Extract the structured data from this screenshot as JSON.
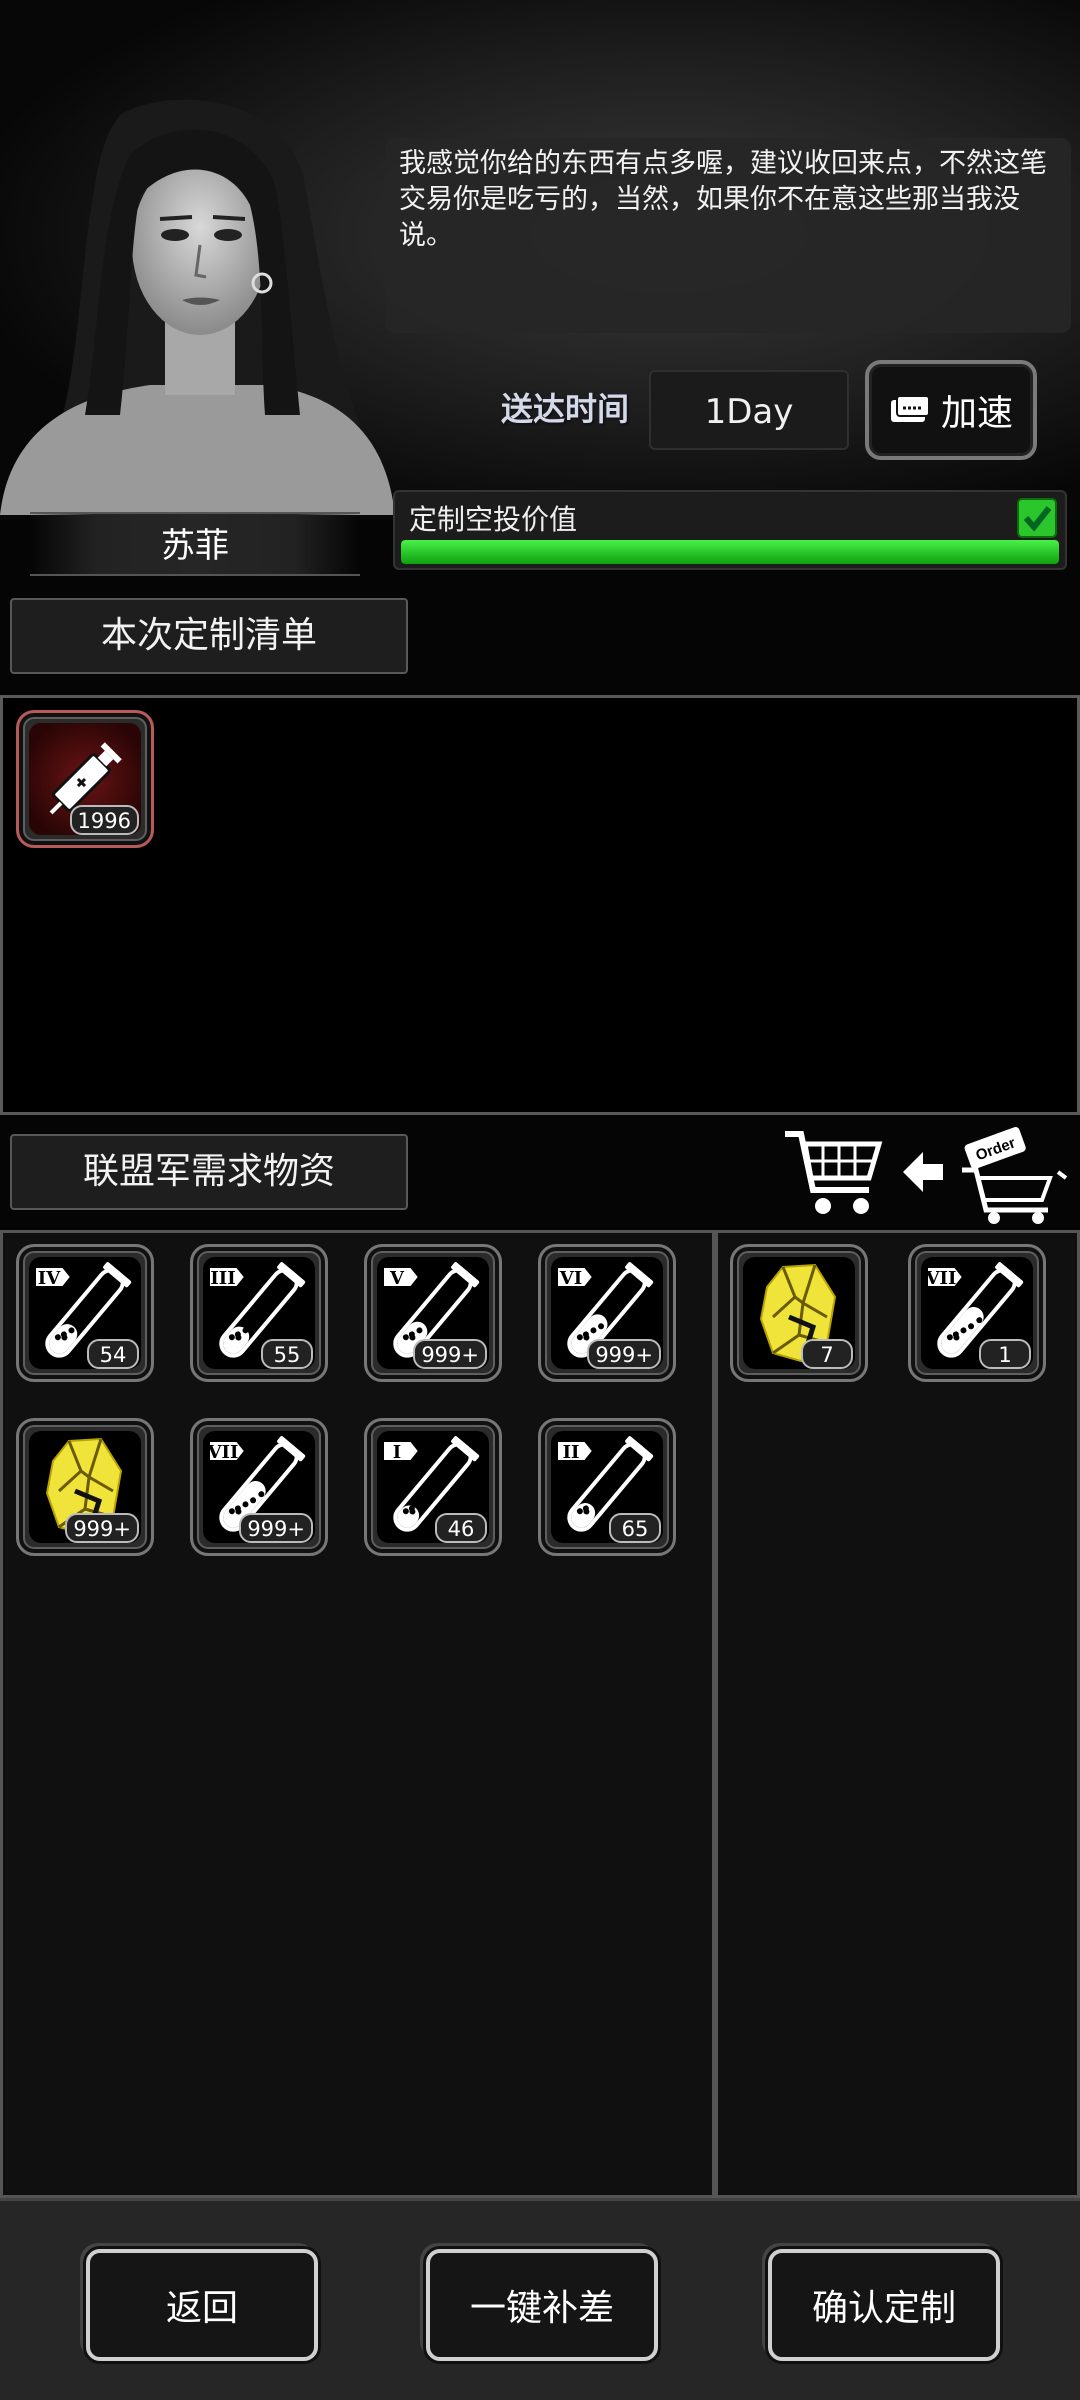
{
  "character": {
    "name": "苏菲"
  },
  "dialog": {
    "text": "我感觉你给的东西有点多喔，建议收回来点，不然这笔交易你是吃亏的，当然，如果你不在意这些那当我没说。"
  },
  "delivery": {
    "label": "送达时间",
    "value": "1Day",
    "speedup_label": "加速"
  },
  "airdrop_value": {
    "label": "定制空投价值",
    "progress": 1.0,
    "complete": true
  },
  "order_list": {
    "title": "本次定制清单",
    "items": [
      {
        "icon": "syringe-icon",
        "count": "1996"
      }
    ]
  },
  "supplies": {
    "title": "联盟军需求物资",
    "items": [
      {
        "icon": "test-tube-icon",
        "tier": "IV",
        "level": 0.35,
        "count": "54"
      },
      {
        "icon": "test-tube-icon",
        "tier": "III",
        "level": 0.3,
        "count": "55"
      },
      {
        "icon": "test-tube-icon",
        "tier": "V",
        "level": 0.4,
        "count": "999+"
      },
      {
        "icon": "test-tube-icon",
        "tier": "VI",
        "level": 0.55,
        "count": "999+"
      },
      {
        "icon": "gold-ore-icon",
        "count": "999+"
      },
      {
        "icon": "test-tube-icon",
        "tier": "VII",
        "level": 0.7,
        "count": "999+"
      },
      {
        "icon": "test-tube-icon",
        "tier": "I",
        "level": 0.2,
        "count": "46"
      },
      {
        "icon": "test-tube-icon",
        "tier": "II",
        "level": 0.25,
        "count": "65"
      }
    ]
  },
  "selected": {
    "items": [
      {
        "icon": "gold-ore-icon",
        "count": "7"
      },
      {
        "icon": "test-tube-icon",
        "tier": "VII",
        "level": 0.7,
        "count": "1"
      }
    ]
  },
  "footer": {
    "back_label": "返回",
    "fill_label": "一键补差",
    "confirm_label": "确认定制"
  },
  "colors": {
    "progress": "#22c522",
    "gold": "#f3e23a",
    "syringe_bg": "#5a1010"
  }
}
